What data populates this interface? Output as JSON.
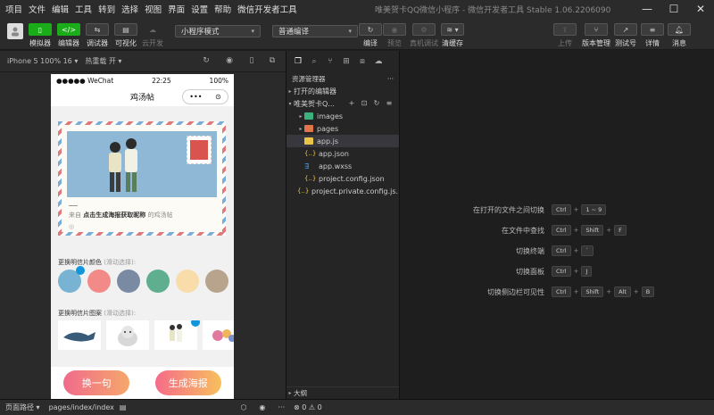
{
  "menu": [
    "项目",
    "文件",
    "编辑",
    "工具",
    "转到",
    "选择",
    "视图",
    "界面",
    "设置",
    "帮助",
    "微信开发者工具"
  ],
  "window_title": "唯美贺卡QQ微信小程序 - 微信开发者工具 Stable 1.06.2206090",
  "window_controls": {
    "minimize": "—",
    "maximize": "☐",
    "close": "✕"
  },
  "toolbar": {
    "simulator": "模拟器",
    "editor": "编辑器",
    "debugger": "调试器",
    "visual": "可视化",
    "cloud": "云开发",
    "mode_select": "小程序模式",
    "compile_select": "普通编译",
    "compile": "编译",
    "preview": "预览",
    "real_debug": "真机调试",
    "clear_cache": "清缓存",
    "upload": "上传",
    "version_mgmt": "版本管理",
    "test_account": "测试号",
    "details": "详情",
    "messages": "消息"
  },
  "subbar": {
    "device": "iPhone 5 100% 16 ▾",
    "hot_reload": "热重载 开 ▾"
  },
  "phone": {
    "status_left": "●●●●● WeChat",
    "status_time": "22:25",
    "status_right": "100%",
    "nav_title": "鸡汤帖",
    "capsule_more": "•••",
    "capsule_close": "⊙",
    "card_from_prefix": "来自",
    "card_from_bold": "点击生成海报获取昵称",
    "card_from_suffix": "的鸡汤帖",
    "card_loc": "◎",
    "color_title": "更换明信片颜色",
    "color_hint": "(滑动选择):",
    "colors": [
      "#79b3d3",
      "#f28b88",
      "#7b8aa3",
      "#5fae8f",
      "#f8dcaa",
      "#b8a48d"
    ],
    "pattern_title": "更换明信片图案",
    "pattern_hint": "(滑动选择):",
    "btn_change": "换一句",
    "btn_poster": "生成海报"
  },
  "explorer": {
    "header": "资源管理器",
    "header_more": "···",
    "open_editors": "打开的编辑器",
    "project": "唯美贺卡Q...",
    "files": [
      {
        "name": "images",
        "type": "folder-green"
      },
      {
        "name": "pages",
        "type": "folder-orange"
      },
      {
        "name": "app.js",
        "type": "js"
      },
      {
        "name": "app.json",
        "type": "json"
      },
      {
        "name": "app.wxss",
        "type": "wxss"
      },
      {
        "name": "project.config.json",
        "type": "json"
      },
      {
        "name": "project.private.config.js...",
        "type": "json"
      }
    ],
    "outline": "大纲"
  },
  "shortcuts": [
    {
      "name": "在打开的文件之间切换",
      "keys": [
        "Ctrl",
        "1 ~ 9"
      ]
    },
    {
      "name": "在文件中查找",
      "keys": [
        "Ctrl",
        "Shift",
        "F"
      ]
    },
    {
      "name": "切换终端",
      "keys": [
        "Ctrl",
        "`"
      ]
    },
    {
      "name": "切换面板",
      "keys": [
        "Ctrl",
        "J"
      ]
    },
    {
      "name": "切换侧边栏可见性",
      "keys": [
        "Ctrl",
        "Shift",
        "Alt",
        "B"
      ]
    }
  ],
  "statusbar": {
    "page_path_label": "页面路径 ▾",
    "page_path": "pages/index/index",
    "errors": "⊗ 0 ⚠ 0"
  }
}
